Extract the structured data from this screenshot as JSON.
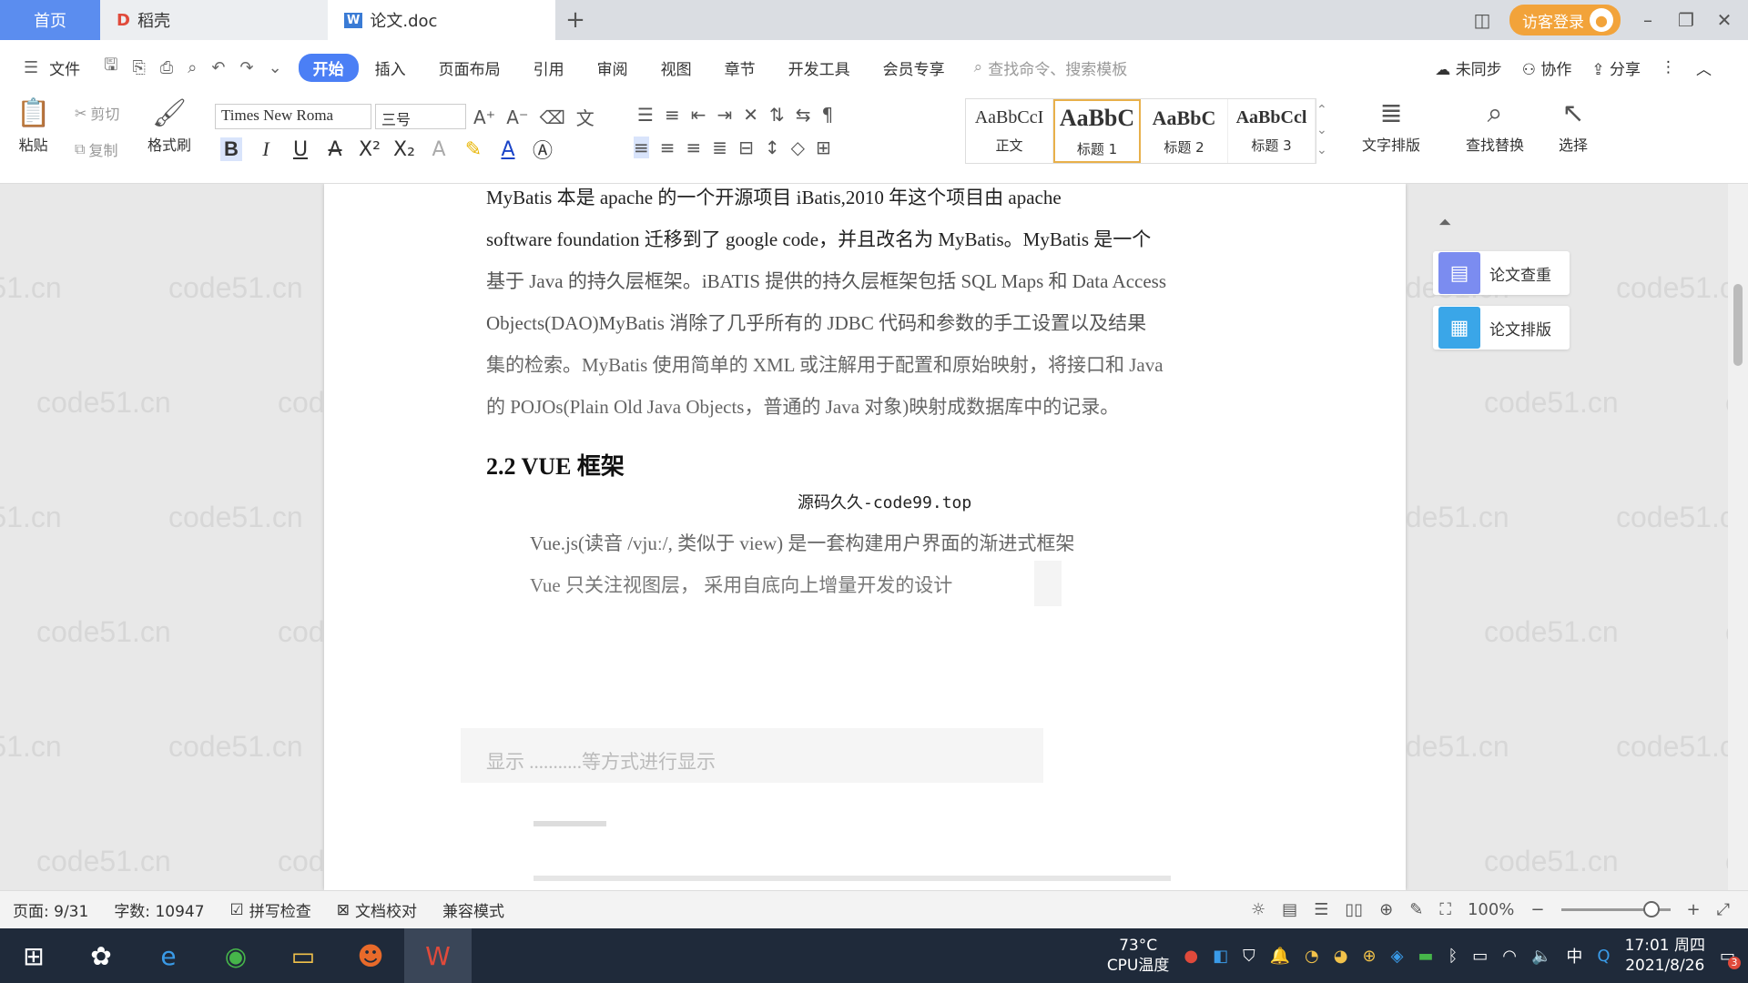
{
  "tabs": {
    "home": "首页",
    "docer": "稻壳",
    "current": "论文.doc",
    "add": "+"
  },
  "titlebar": {
    "login": "访客登录"
  },
  "menu": {
    "file": "文件",
    "items": [
      "开始",
      "插入",
      "页面布局",
      "引用",
      "审阅",
      "视图",
      "章节",
      "开发工具",
      "会员专享"
    ],
    "search_placeholder": "查找命令、搜索模板",
    "sync": "未同步",
    "collab": "协作",
    "share": "分享"
  },
  "ribbon": {
    "paste": "粘贴",
    "cut": "剪切",
    "copy": "复制",
    "format_painter": "格式刷",
    "font_name": "Times New Roma",
    "font_size": "三号",
    "styles": [
      {
        "preview": "AaBbCcI",
        "label": "正文"
      },
      {
        "preview": "AaBbC",
        "label": "标题 1"
      },
      {
        "preview": "AaBbC",
        "label": "标题 2"
      },
      {
        "preview": "AaBbCcl",
        "label": "标题 3"
      }
    ],
    "text_layout": "文字排版",
    "find_replace": "查找替换",
    "select": "选择"
  },
  "document": {
    "line1": "MyBatis 本是 apache 的一个开源项目 iBatis,2010 年这个项目由 apache",
    "line2": "software foundation 迁移到了 google code，并且改名为 MyBatis。MyBatis 是一个",
    "line3": "基于 Java 的持久层框架。iBATIS 提供的持久层框架包括 SQL Maps 和 Data Access",
    "line4": "Objects(DAO)MyBatis 消除了几乎所有的 JDBC 代码和参数的手工设置以及结果",
    "line5": "集的检索。MyBatis 使用简单的 XML 或注解用于配置和原始映射，将接口和 Java",
    "line6": "的 POJOs(Plain Old Java Objects，普通的 Java 对象)映射成数据库中的记录。",
    "heading": "2.2 VUE 框架",
    "source": "源码久久-code99.top",
    "vue1": "Vue.js(读音 /vjuː/, 类似于 view) 是一套构建用户界面的渐进式框架",
    "vue2": "Vue 只关注视图层， 采用自底向上增量开发的设计",
    "vue3": "显示  ...........等方式进行显示"
  },
  "side_panel": {
    "check": "论文查重",
    "layout": "论文排版"
  },
  "watermark": "code51.cn",
  "status": {
    "page": "页面: 9/31",
    "words": "字数: 10947",
    "spell": "拼写检查",
    "proof": "文档校对",
    "compat": "兼容模式",
    "zoom": "100%"
  },
  "taskbar": {
    "cpu_temp": "73°C",
    "cpu_label": "CPU温度",
    "ime": "中",
    "time": "17:01 周四",
    "date": "2021/8/26",
    "notif_count": "3"
  }
}
